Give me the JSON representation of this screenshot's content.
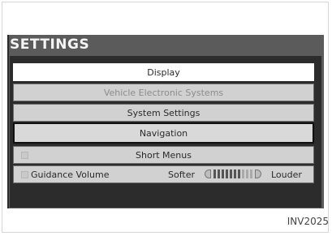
{
  "screen": {
    "title": "SETTINGS",
    "menu": [
      {
        "label": "Display",
        "state": "selected"
      },
      {
        "label": "Vehicle Electronic Systems",
        "state": "disabled"
      },
      {
        "label": "System Settings",
        "state": "normal"
      },
      {
        "label": "Navigation",
        "state": "focused"
      },
      {
        "label": "Short Menus",
        "state": "normal",
        "checked": false
      },
      {
        "label": "Guidance Volume",
        "state": "normal",
        "checked": false
      }
    ],
    "volume": {
      "softer_label": "Softer",
      "louder_label": "Louder",
      "level_fraction": 0.7
    }
  },
  "figure_code": "INV2025"
}
